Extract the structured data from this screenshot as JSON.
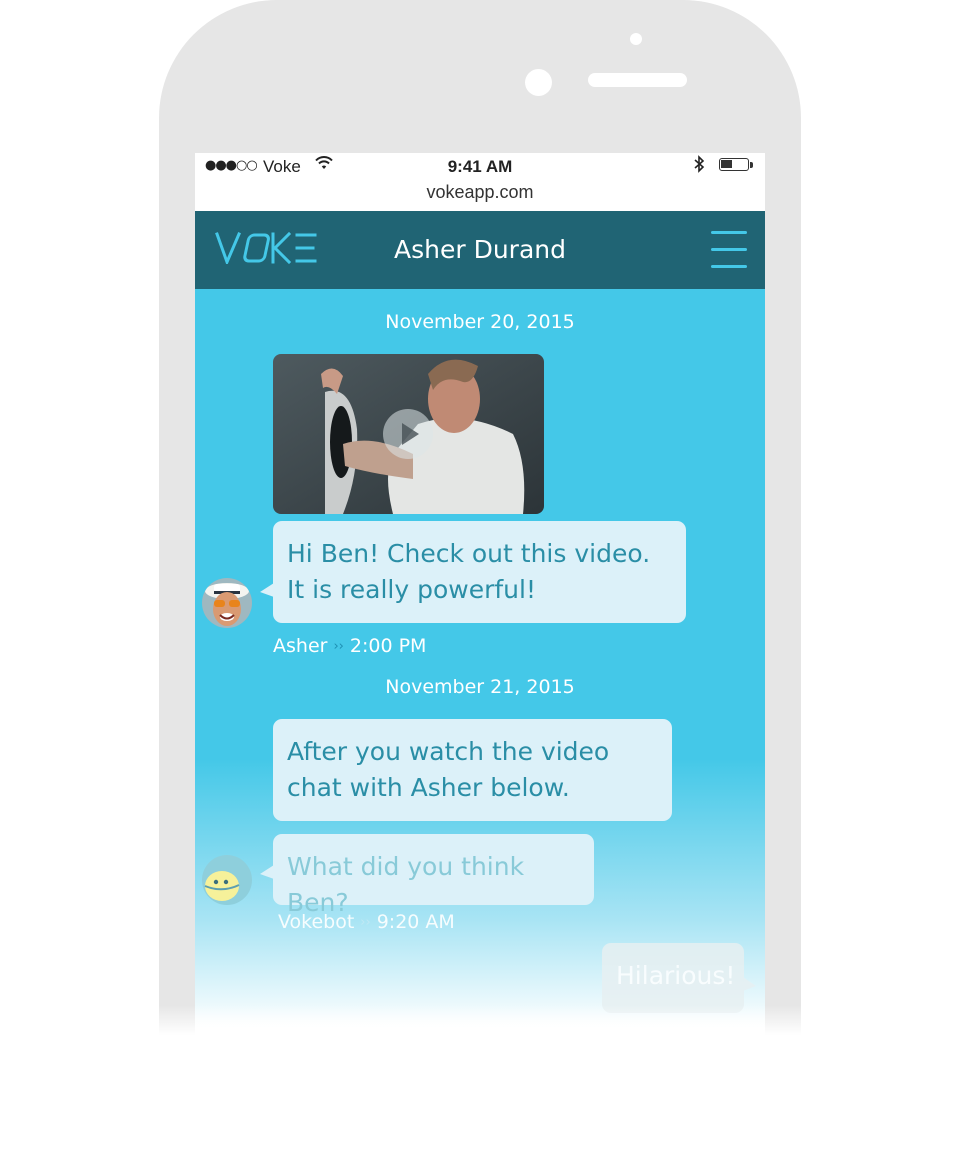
{
  "status_bar": {
    "signal": "●●●○○",
    "carrier": "Voke",
    "time": "9:41 AM",
    "bluetooth": "✱",
    "battery_level": 0.35,
    "url": "vokeapp.com"
  },
  "navbar": {
    "logo_text": "VOKE",
    "title": "Asher Durand",
    "menu_icon": "hamburger-menu-icon"
  },
  "conversation": {
    "date_1": "November 20, 2015",
    "video_icon": "play-icon",
    "message_1": {
      "text": "Hi Ben! Check out this video. It is really powerful!",
      "sender": "Asher",
      "time": "2:00 PM"
    },
    "date_2": "November 21, 2015",
    "message_2": {
      "text": "After you watch the video chat with Asher below."
    },
    "message_3": {
      "text": "What did you think Ben?",
      "sender": "Vokebot",
      "time": "9:20 AM"
    },
    "message_4": {
      "text": "Hilarious!"
    },
    "separator": "››"
  },
  "colors": {
    "navbar": "#206474",
    "chat_background": "#44c8e8",
    "bubble": "#dcf1f9",
    "bubble_text": "#2a8ea6",
    "accent": "#44c8e8"
  }
}
